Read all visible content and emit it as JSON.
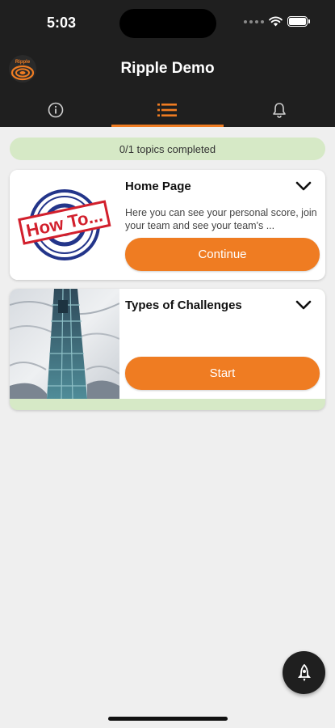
{
  "status_bar": {
    "time": "5:03"
  },
  "header": {
    "title": "Ripple Demo",
    "logo_text": "Ripple"
  },
  "tabs": [
    {
      "icon": "info-icon",
      "active": false
    },
    {
      "icon": "list-icon",
      "active": true
    },
    {
      "icon": "bell-icon",
      "active": false
    }
  ],
  "progress": {
    "label": "0/1 topics completed",
    "completed": 0,
    "total": 1
  },
  "topics": [
    {
      "title": "Home Page",
      "thumbnail_text": "How To...",
      "description": "Here you can see your personal score, join your team and see your team's ...",
      "button_label": "Continue"
    },
    {
      "title": "Types of Challenges",
      "description": "",
      "button_label": "Start"
    }
  ],
  "fab": {
    "icon": "rocket-icon"
  },
  "colors": {
    "accent": "#ef7c22",
    "header_bg": "#1f1f1f",
    "progress_bg": "#d6e9c6",
    "page_bg": "#efefef"
  }
}
